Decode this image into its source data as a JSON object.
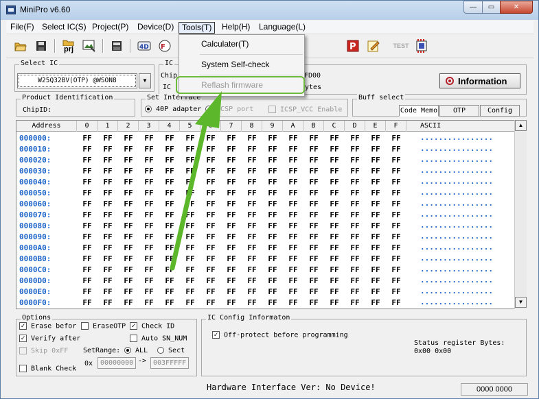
{
  "window": {
    "title": "MiniPro v6.60"
  },
  "menubar": [
    {
      "label": "File(F)"
    },
    {
      "label": "Select IC(S)"
    },
    {
      "label": "Project(P)"
    },
    {
      "label": "Device(D)"
    },
    {
      "label": "Tools(T)"
    },
    {
      "label": "Help(H)"
    },
    {
      "label": "Language(L)"
    }
  ],
  "tools_menu": {
    "items": [
      {
        "label": "Calculater(T)"
      },
      {
        "label": "System Self-check"
      },
      {
        "label": "Reflash firmware"
      }
    ]
  },
  "toolbar": {
    "prj_label": "prj",
    "test_label": "TEST"
  },
  "select_ic": {
    "title": "Select IC",
    "value": "W25Q32BV(OTP) @WSON8"
  },
  "ic_info": {
    "title": "IC",
    "chip_label": "Chip",
    "ic_label": "IC",
    "partial1": "FD00",
    "partial2": "ytes"
  },
  "information_button": {
    "label": "Information"
  },
  "product_id": {
    "title": "Product Identification",
    "chipid_label": "ChipID:"
  },
  "set_interface": {
    "title": "Set Interface",
    "opt1": "40P adapter",
    "opt2": "ICSP port",
    "opt3": "ICSP_VCC Enable"
  },
  "buff_select": {
    "title": "Buff select",
    "tabs": [
      {
        "label": "Code Memo"
      },
      {
        "label": "OTP"
      },
      {
        "label": "Config"
      }
    ]
  },
  "hex_view": {
    "address_header": "Address",
    "columns": [
      "0",
      "1",
      "2",
      "3",
      "4",
      "5",
      "6",
      "7",
      "8",
      "9",
      "A",
      "B",
      "C",
      "D",
      "E",
      "F"
    ],
    "ascii_header": "ASCII",
    "byte_value": "FF",
    "ascii_value": "................",
    "rows": [
      "000000:",
      "000010:",
      "000020:",
      "000030:",
      "000040:",
      "000050:",
      "000060:",
      "000070:",
      "000080:",
      "000090:",
      "0000A0:",
      "0000B0:",
      "0000C0:",
      "0000D0:",
      "0000E0:",
      "0000F0:"
    ]
  },
  "options": {
    "title": "Options",
    "erase_before": "Erase befor",
    "erase_otp": "EraseOTP",
    "check_id": "Check ID",
    "verify_after": "Verify after",
    "auto_sn": "Auto SN_NUM",
    "skip_0xff": "Skip 0xFF",
    "set_range": "SetRange:",
    "all": "ALL",
    "sect": "Sect",
    "ox": "0x",
    "range_start": "00000000",
    "arrow": "->",
    "range_end": "003FFFFF",
    "blank_check": "Blank Check"
  },
  "ic_config": {
    "title": "IC Config Informaton",
    "off_protect": "Off-protect before programming",
    "status_label": "Status register Bytes:",
    "status_value": "0x00 0x00"
  },
  "statusbar": {
    "hardware": "Hardware Interface Ver: No Device!",
    "counter": "0000 0000"
  },
  "colors": {
    "address_blue": "#1c64c8",
    "arrow_green": "#5cb82a"
  }
}
